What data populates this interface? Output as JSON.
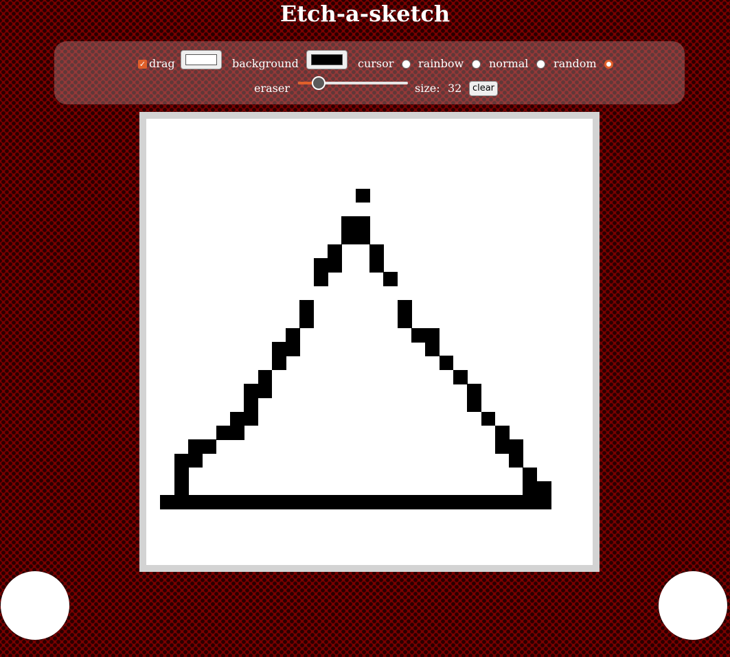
{
  "app": {
    "title": "Etch-a-sketch"
  },
  "controls": {
    "drag_label": "drag",
    "drag_checked": true,
    "background_label": "background",
    "background_color": "#ffffff",
    "cursor_label": "cursor",
    "cursor_color": "#000000",
    "modes": [
      {
        "label": "rainbow",
        "checked": false
      },
      {
        "label": "normal",
        "checked": false
      },
      {
        "label": "random",
        "checked": false
      },
      {
        "label": "eraser",
        "checked": true
      }
    ],
    "size_label": "size:",
    "size_value": "32",
    "size_min": 16,
    "size_max": 100,
    "clear_label": "clear"
  },
  "grid": {
    "size": 32,
    "ink_color": "#000000",
    "background": "#ffffff",
    "filled_cells": [
      [
        15,
        5
      ],
      [
        14,
        7
      ],
      [
        15,
        7
      ],
      [
        14,
        8
      ],
      [
        15,
        8
      ],
      [
        13,
        9
      ],
      [
        16,
        9
      ],
      [
        12,
        10
      ],
      [
        13,
        10
      ],
      [
        16,
        10
      ],
      [
        12,
        11
      ],
      [
        17,
        11
      ],
      [
        11,
        13
      ],
      [
        18,
        13
      ],
      [
        11,
        14
      ],
      [
        18,
        14
      ],
      [
        10,
        15
      ],
      [
        19,
        15
      ],
      [
        20,
        15
      ],
      [
        9,
        16
      ],
      [
        10,
        16
      ],
      [
        20,
        16
      ],
      [
        9,
        17
      ],
      [
        21,
        17
      ],
      [
        8,
        18
      ],
      [
        22,
        18
      ],
      [
        7,
        19
      ],
      [
        8,
        19
      ],
      [
        23,
        19
      ],
      [
        7,
        20
      ],
      [
        23,
        20
      ],
      [
        6,
        21
      ],
      [
        7,
        21
      ],
      [
        24,
        21
      ],
      [
        5,
        22
      ],
      [
        6,
        22
      ],
      [
        25,
        22
      ],
      [
        3,
        23
      ],
      [
        4,
        23
      ],
      [
        25,
        23
      ],
      [
        26,
        23
      ],
      [
        2,
        24
      ],
      [
        3,
        24
      ],
      [
        26,
        24
      ],
      [
        2,
        25
      ],
      [
        27,
        25
      ],
      [
        2,
        26
      ],
      [
        27,
        26
      ],
      [
        28,
        26
      ]
    ],
    "filled_rows": [
      {
        "row": 27,
        "from": 1,
        "to": 28
      }
    ]
  }
}
